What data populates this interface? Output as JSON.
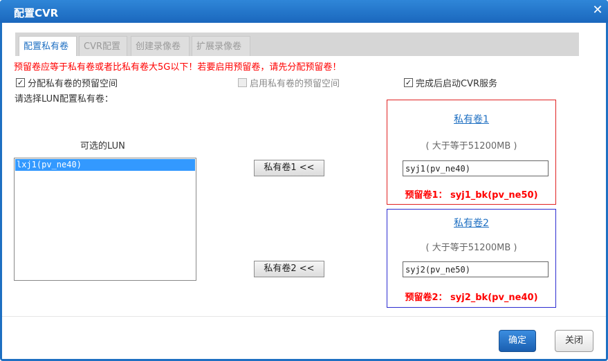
{
  "window": {
    "title": "配置CVR",
    "close_glyph": "✕"
  },
  "tabs": [
    {
      "label": "配置私有卷",
      "active": true
    },
    {
      "label": "CVR配置",
      "active": false
    },
    {
      "label": "创建录像卷",
      "active": false
    },
    {
      "label": "扩展录像卷",
      "active": false
    }
  ],
  "warning_text": "预留卷应等于私有卷或者比私有卷大5G以下！若要启用预留卷，请先分配预留卷！",
  "checkboxes": [
    {
      "label": "分配私有卷的预留空间",
      "checked": true,
      "enabled": true
    },
    {
      "label": "启用私有卷的预留空间",
      "checked": false,
      "enabled": false
    },
    {
      "label": "完成后启动CVR服务",
      "checked": true,
      "enabled": true
    }
  ],
  "check_glyph": "✓",
  "select_prompt": "请选择LUN配置私有卷：",
  "lun": {
    "title": "可选的LUN",
    "items": [
      "lxj1(pv_ne40)"
    ]
  },
  "move_buttons": [
    "私有卷1 <<",
    "私有卷2 <<"
  ],
  "volumes": [
    {
      "title": "私有卷1",
      "hint": "( 大于等于51200MB )",
      "value": "syj1(pv_ne40)",
      "reserve": "预留卷1： syj1_bk(pv_ne50)"
    },
    {
      "title": "私有卷2",
      "hint": "( 大于等于51200MB )",
      "value": "syj2(pv_ne50)",
      "reserve": "预留卷2： syj2_bk(pv_ne40)"
    }
  ],
  "footer": {
    "ok_label": "确定",
    "close_label": "关闭"
  },
  "colors": {
    "titlebar": "#1e6fc2",
    "warning": "#ff0000",
    "volume1_border": "#e02020",
    "volume2_border": "#2a2ad0",
    "selection": "#3399ff"
  }
}
